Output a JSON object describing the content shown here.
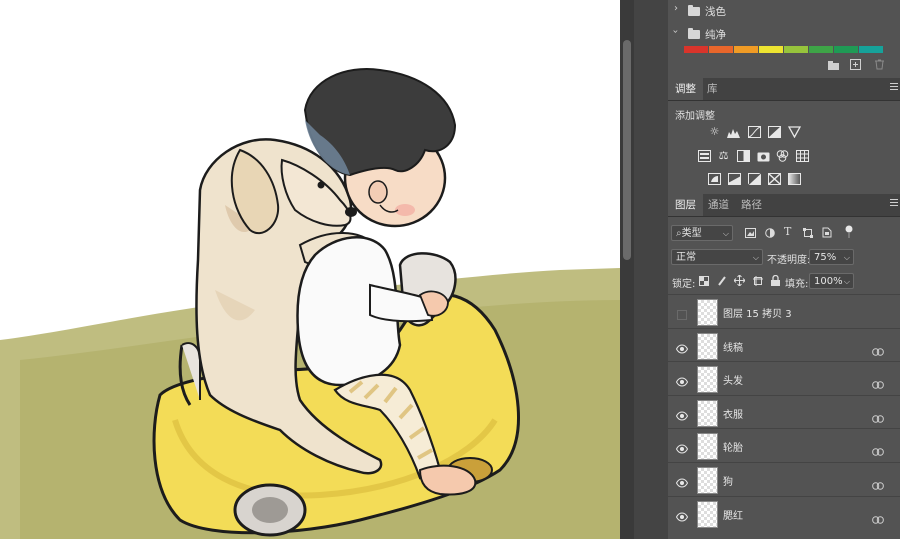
{
  "library_panel": {
    "folders": [
      {
        "label": "浅色",
        "expanded": false
      },
      {
        "label": "纯净",
        "expanded": true
      }
    ],
    "swatch_colors": [
      "#d9342b",
      "#e8662b",
      "#f09b25",
      "#ede431",
      "#97c43c",
      "#3ea447",
      "#1f9a55",
      "#16a29a"
    ],
    "footer_icons": [
      "new-group-icon",
      "new-swatch-icon",
      "trash-icon"
    ]
  },
  "adjustments_panel": {
    "tabs": [
      {
        "label": "调整",
        "active": true
      },
      {
        "label": "库",
        "active": false
      }
    ],
    "heading": "添加调整",
    "icon_rows": [
      [
        "brightness-icon",
        "levels-icon",
        "curves-icon",
        "exposure-icon",
        "vibrance-icon"
      ],
      [
        "hue-saturation-icon",
        "color-balance-icon",
        "black-white-icon",
        "photo-filter-icon",
        "channel-mixer-icon",
        "color-lookup-icon"
      ],
      [
        "invert-icon",
        "posterize-icon",
        "threshold-icon",
        "selective-color-icon",
        "gradient-map-icon"
      ]
    ]
  },
  "layers_panel": {
    "tabs": [
      {
        "label": "图层",
        "active": true
      },
      {
        "label": "通道",
        "active": false
      },
      {
        "label": "路径",
        "active": false
      }
    ],
    "filter": {
      "label": "类型",
      "icons": [
        "pixel-filter-icon",
        "adjustment-filter-icon",
        "type-filter-icon",
        "shape-filter-icon",
        "smart-object-filter-icon",
        "filter-toggle-icon"
      ]
    },
    "blend_mode": "正常",
    "opacity_label": "不透明度:",
    "opacity_value": "75%",
    "lock_label": "锁定:",
    "lock_icons": [
      "lock-transparent-icon",
      "lock-paint-icon",
      "lock-position-icon",
      "lock-artboard-icon",
      "lock-all-icon"
    ],
    "fill_label": "填充:",
    "fill_value": "100%",
    "layers": [
      {
        "name": "图层 15 拷贝 3",
        "visible": false,
        "linked": false
      },
      {
        "name": "线稿",
        "visible": true,
        "linked": true
      },
      {
        "name": "头发",
        "visible": true,
        "linked": true
      },
      {
        "name": "衣服",
        "visible": true,
        "linked": true
      },
      {
        "name": "轮胎",
        "visible": true,
        "linked": true
      },
      {
        "name": "狗",
        "visible": true,
        "linked": true
      },
      {
        "name": "腮红",
        "visible": true,
        "linked": true
      }
    ]
  }
}
